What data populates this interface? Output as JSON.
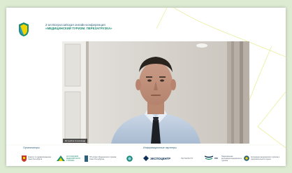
{
  "header": {
    "line1": "2-ая Всероссийская онлайн-конференция",
    "line2": "«МЕДИЦИНСКИЙ ТУРИЗМ. ПЕРЕЗАГРУЗКА»"
  },
  "video": {
    "speaker_name": "Ястребов Александр"
  },
  "footer": {
    "organizers_label": "Организаторы",
    "info_partners_label": "Информационные партнеры",
    "partners": {
      "p1": "Комитет по здравоохранению Санкт-Петербурга",
      "p2": "АССОЦИАЦИЯ МЕДИЦИНСКОГО ТУРИЗМА",
      "p3": "НП «Совет Медицинского туризма Санкт-Петербурга»",
      "p5": "ЭКСПОЦЕНТР",
      "p6": "ПЕТЕРБУРГ",
      "p7": "ВТБ",
      "p8": "Национальная ассоциация медицинского туризма",
      "p9": "Ассоциация медицинского туризма и оздоровительного отдыха"
    }
  },
  "colors": {
    "background": "#dcebd2",
    "accent_yellow": "#f2d400",
    "accent_teal": "#1f8c73",
    "accent_blue": "#2b5f7a"
  }
}
